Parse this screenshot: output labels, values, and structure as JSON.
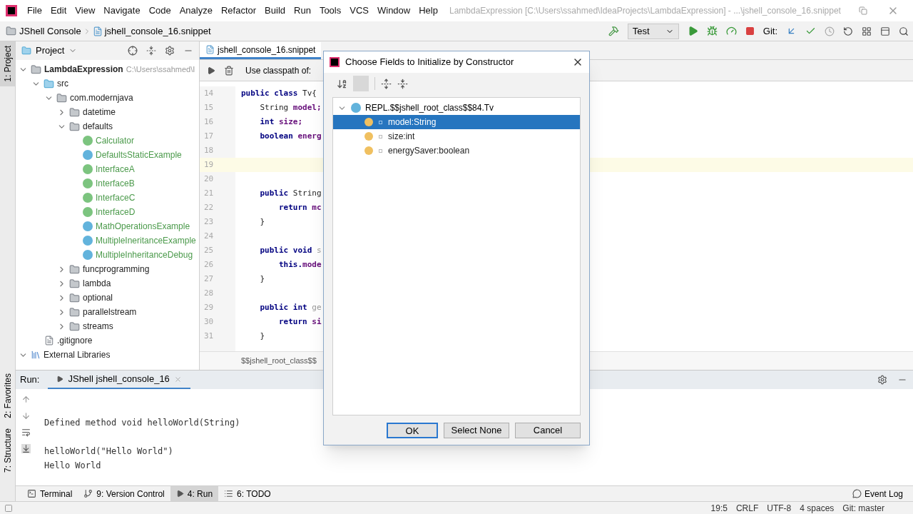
{
  "menu": {
    "items": [
      "File",
      "Edit",
      "View",
      "Navigate",
      "Code",
      "Analyze",
      "Refactor",
      "Build",
      "Run",
      "Tools",
      "VCS",
      "Window",
      "Help"
    ],
    "title": "LambdaExpression [C:\\Users\\ssahmed\\IdeaProjects\\LambdaExpression] - ...\\jshell_console_16.snippet"
  },
  "navbar": {
    "breadcrumbs": [
      "JShell Console",
      "jshell_console_16.snippet"
    ],
    "run_config": "Test",
    "git_label": "Git:"
  },
  "side_tabs": {
    "top": "1: Project",
    "bottom": [
      "2: Favorites",
      "7: Structure"
    ]
  },
  "project": {
    "header": "Project",
    "tree": [
      {
        "label": "LambdaExpression",
        "path": "C:\\Users\\ssahmed\\I",
        "kind": "project",
        "expanded": true,
        "children": [
          {
            "label": "src",
            "kind": "source",
            "expanded": true,
            "children": [
              {
                "label": "com.modernjava",
                "kind": "package",
                "expanded": true,
                "children": [
                  {
                    "label": "datetime",
                    "kind": "package",
                    "expanded": false
                  },
                  {
                    "label": "defaults",
                    "kind": "package",
                    "expanded": true,
                    "children": [
                      {
                        "label": "Calculator",
                        "kind": "interface"
                      },
                      {
                        "label": "DefaultsStaticExample",
                        "kind": "runnable"
                      },
                      {
                        "label": "InterfaceA",
                        "kind": "interface"
                      },
                      {
                        "label": "InterfaceB",
                        "kind": "interface"
                      },
                      {
                        "label": "InterfaceC",
                        "kind": "interface"
                      },
                      {
                        "label": "InterfaceD",
                        "kind": "interface"
                      },
                      {
                        "label": "MathOperationsExample",
                        "kind": "runnable"
                      },
                      {
                        "label": "MultipleIneritanceExample",
                        "kind": "runnable"
                      },
                      {
                        "label": "MultipleInheritanceDebug",
                        "kind": "class"
                      }
                    ]
                  },
                  {
                    "label": "funcprogramming",
                    "kind": "package",
                    "expanded": false
                  },
                  {
                    "label": "lambda",
                    "kind": "package",
                    "expanded": false
                  },
                  {
                    "label": "optional",
                    "kind": "package",
                    "expanded": false
                  },
                  {
                    "label": "parallelstream",
                    "kind": "package",
                    "expanded": false
                  },
                  {
                    "label": "streams",
                    "kind": "package",
                    "expanded": false
                  }
                ]
              }
            ]
          },
          {
            "label": ".gitignore",
            "kind": "file"
          }
        ]
      },
      {
        "label": "External Libraries",
        "kind": "libraries",
        "expanded": true
      }
    ]
  },
  "editor": {
    "tab": "jshell_console_16.snippet",
    "toolbar_label": "Use classpath of:",
    "breadcrumb": "$$jshell_root_class$$",
    "lines": [
      {
        "num": "14",
        "current": false,
        "tokens": [
          {
            "t": "public class ",
            "kind": "keyword"
          },
          {
            "t": "Tv{",
            "kind": "plain"
          }
        ]
      },
      {
        "num": "15",
        "current": false,
        "tokens": [
          {
            "t": "    String ",
            "kind": "plain"
          },
          {
            "t": "model;",
            "kind": "field"
          }
        ]
      },
      {
        "num": "16",
        "current": false,
        "tokens": [
          {
            "t": "    int ",
            "kind": "keyword"
          },
          {
            "t": "size;",
            "kind": "field"
          }
        ]
      },
      {
        "num": "17",
        "current": false,
        "tokens": [
          {
            "t": "    boolean ",
            "kind": "keyword"
          },
          {
            "t": "energ",
            "kind": "field"
          }
        ]
      },
      {
        "num": "18",
        "current": false
      },
      {
        "num": "19",
        "current": true
      },
      {
        "num": "20",
        "current": false
      },
      {
        "num": "21",
        "current": false,
        "tokens": [
          {
            "t": "    public ",
            "kind": "keyword"
          },
          {
            "t": "String",
            "kind": "plain"
          }
        ]
      },
      {
        "num": "22",
        "current": false,
        "tokens": [
          {
            "t": "        return ",
            "kind": "keyword"
          },
          {
            "t": "mc",
            "kind": "field"
          }
        ]
      },
      {
        "num": "23",
        "current": false,
        "tokens": [
          {
            "t": "    }",
            "kind": "plain"
          }
        ]
      },
      {
        "num": "24",
        "current": false
      },
      {
        "num": "25",
        "current": false,
        "tokens": [
          {
            "t": "    public void ",
            "kind": "keyword"
          },
          {
            "t": "s",
            "kind": "dim"
          }
        ]
      },
      {
        "num": "26",
        "current": false,
        "tokens": [
          {
            "t": "        this.",
            "kind": "keyword"
          },
          {
            "t": "mode",
            "kind": "field"
          }
        ]
      },
      {
        "num": "27",
        "current": false,
        "tokens": [
          {
            "t": "    }",
            "kind": "plain"
          }
        ]
      },
      {
        "num": "28",
        "current": false
      },
      {
        "num": "29",
        "current": false,
        "tokens": [
          {
            "t": "    public int ",
            "kind": "keyword"
          },
          {
            "t": "ge",
            "kind": "dim"
          }
        ]
      },
      {
        "num": "30",
        "current": false,
        "tokens": [
          {
            "t": "        return ",
            "kind": "keyword"
          },
          {
            "t": "si",
            "kind": "field"
          }
        ]
      },
      {
        "num": "31",
        "current": false,
        "tokens": [
          {
            "t": "    }",
            "kind": "plain"
          }
        ]
      }
    ]
  },
  "run_panel": {
    "label": "Run:",
    "tab": "JShell jshell_console_16",
    "console_blocks": [
      [
        "Defined method void helloWorld(String)"
      ],
      [
        "helloWorld(\"Hello World\")",
        "Hello World"
      ]
    ]
  },
  "tool_tabs": [
    {
      "label": "Terminal",
      "kind": "terminal",
      "selected": false
    },
    {
      "label": "9: Version Control",
      "kind": "vcs",
      "selected": false
    },
    {
      "label": "4: Run",
      "kind": "run",
      "selected": true
    },
    {
      "label": "6: TODO",
      "kind": "todo",
      "selected": false
    }
  ],
  "event_log": "Event Log",
  "status_bar": [
    "19:5",
    "CRLF",
    "UTF-8",
    "4 spaces",
    "Git: master"
  ],
  "dialog": {
    "title": "Choose Fields to Initialize by Constructor",
    "root": {
      "label": "REPL.$$jshell_root_class$$84.Tv",
      "expanded": true,
      "children": [
        {
          "label": "model:String",
          "selected": true
        },
        {
          "label": "size:int",
          "selected": false
        },
        {
          "label": "energySaver:boolean",
          "selected": false
        }
      ]
    },
    "buttons": [
      {
        "label": "OK",
        "kind": "default"
      },
      {
        "label": "Select None",
        "kind": "normal"
      },
      {
        "label": "Cancel",
        "kind": "normal"
      }
    ]
  }
}
